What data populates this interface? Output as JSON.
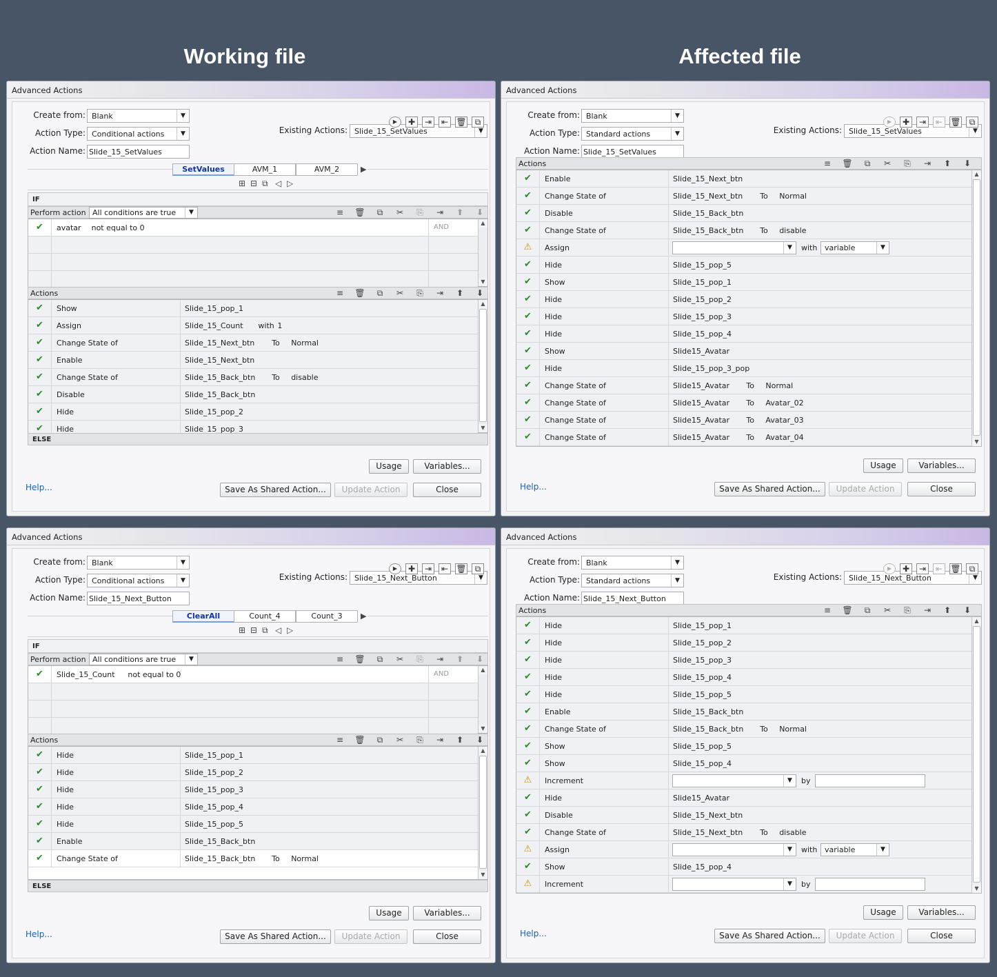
{
  "headings": {
    "working": "Working file",
    "affected": "Affected file"
  },
  "common": {
    "dialog_title": "Advanced Actions",
    "create_from_label": "Create from:",
    "action_type_label": "Action Type:",
    "action_name_label": "Action Name:",
    "existing_label": "Existing Actions:",
    "if_label": "IF",
    "else_label": "ELSE",
    "perform_label": "Perform action if:",
    "perform_value": "All conditions are true",
    "actions_label": "Actions",
    "and_label": "AND",
    "usage": "Usage",
    "variables": "Variables...",
    "help": "Help...",
    "save_shared": "Save As Shared Action...",
    "update": "Update Action",
    "close": "Close",
    "with": "with",
    "by": "by",
    "variable": "variable",
    "to": "To"
  },
  "d1": {
    "create_from": "Blank",
    "action_type": "Conditional actions",
    "action_name": "Slide_15_SetValues",
    "existing": "Slide_15_SetValues",
    "tabs": [
      "SetValues",
      "AVM_1",
      "AVM_2"
    ],
    "condition": {
      "var": "avatar",
      "op": "not equal to",
      "val": "0"
    },
    "actions": [
      {
        "a": "Show",
        "t": "Slide_15_pop_1"
      },
      {
        "a": "Assign",
        "t": "Slide_15_Count",
        "m": "with",
        "v": "1"
      },
      {
        "a": "Change State of",
        "t": "Slide_15_Next_btn",
        "m": "To",
        "v": "Normal"
      },
      {
        "a": "Enable",
        "t": "Slide_15_Next_btn"
      },
      {
        "a": "Change State of",
        "t": "Slide_15_Back_btn",
        "m": "To",
        "v": "disable"
      },
      {
        "a": "Disable",
        "t": "Slide_15_Back_btn"
      },
      {
        "a": "Hide",
        "t": "Slide_15_pop_2"
      },
      {
        "a": "Hide",
        "t": "Slide_15_pop_3"
      }
    ]
  },
  "d2": {
    "create_from": "Blank",
    "action_type": "Standard actions",
    "action_name": "Slide_15_SetValues",
    "existing": "Slide_15_SetValues",
    "actions": [
      {
        "a": "Enable",
        "t": "Slide_15_Next_btn"
      },
      {
        "a": "Change State of",
        "t": "Slide_15_Next_btn",
        "m": "To",
        "v": "Normal"
      },
      {
        "a": "Disable",
        "t": "Slide_15_Back_btn"
      },
      {
        "a": "Change State of",
        "t": "Slide_15_Back_btn",
        "m": "To",
        "v": "disable"
      },
      {
        "a": "Assign",
        "warn": true,
        "kind": "with"
      },
      {
        "a": "Hide",
        "t": "Slide_15_pop_5"
      },
      {
        "a": "Show",
        "t": "Slide_15_pop_1"
      },
      {
        "a": "Hide",
        "t": "Slide_15_pop_2"
      },
      {
        "a": "Hide",
        "t": "Slide_15_pop_3"
      },
      {
        "a": "Hide",
        "t": "Slide_15_pop_4"
      },
      {
        "a": "Show",
        "t": "Slide15_Avatar"
      },
      {
        "a": "Hide",
        "t": "Slide_15_pop_3_pop"
      },
      {
        "a": "Change State of",
        "t": "Slide15_Avatar",
        "m": "To",
        "v": "Normal"
      },
      {
        "a": "Change State of",
        "t": "Slide15_Avatar",
        "m": "To",
        "v": "Avatar_02"
      },
      {
        "a": "Change State of",
        "t": "Slide15_Avatar",
        "m": "To",
        "v": "Avatar_03"
      },
      {
        "a": "Change State of",
        "t": "Slide15_Avatar",
        "m": "To",
        "v": "Avatar_04"
      }
    ]
  },
  "d3": {
    "create_from": "Blank",
    "action_type": "Conditional actions",
    "action_name": "Slide_15_Next_Button",
    "existing": "Slide_15_Next_Button",
    "tabs": [
      "ClearAll",
      "Count_4",
      "Count_3"
    ],
    "condition": {
      "var": "Slide_15_Count",
      "op": "not equal to",
      "val": "0"
    },
    "actions": [
      {
        "a": "Hide",
        "t": "Slide_15_pop_1"
      },
      {
        "a": "Hide",
        "t": "Slide_15_pop_2"
      },
      {
        "a": "Hide",
        "t": "Slide_15_pop_3"
      },
      {
        "a": "Hide",
        "t": "Slide_15_pop_4"
      },
      {
        "a": "Hide",
        "t": "Slide_15_pop_5"
      },
      {
        "a": "Enable",
        "t": "Slide_15_Back_btn"
      },
      {
        "a": "Change State of",
        "t": "Slide_15_Back_btn",
        "m": "To",
        "v": "Normal"
      }
    ]
  },
  "d4": {
    "create_from": "Blank",
    "action_type": "Standard actions",
    "action_name": "Slide_15_Next_Button",
    "existing": "Slide_15_Next_Button",
    "actions": [
      {
        "a": "Hide",
        "t": "Slide_15_pop_1"
      },
      {
        "a": "Hide",
        "t": "Slide_15_pop_2"
      },
      {
        "a": "Hide",
        "t": "Slide_15_pop_3"
      },
      {
        "a": "Hide",
        "t": "Slide_15_pop_4"
      },
      {
        "a": "Hide",
        "t": "Slide_15_pop_5"
      },
      {
        "a": "Enable",
        "t": "Slide_15_Back_btn"
      },
      {
        "a": "Change State of",
        "t": "Slide_15_Back_btn",
        "m": "To",
        "v": "Normal"
      },
      {
        "a": "Show",
        "t": "Slide_15_pop_5"
      },
      {
        "a": "Show",
        "t": "Slide_15_pop_4"
      },
      {
        "a": "Increment",
        "warn": true,
        "kind": "by"
      },
      {
        "a": "Hide",
        "t": "Slide15_Avatar"
      },
      {
        "a": "Disable",
        "t": "Slide_15_Next_btn"
      },
      {
        "a": "Change State of",
        "t": "Slide_15_Next_btn",
        "m": "To",
        "v": "disable"
      },
      {
        "a": "Assign",
        "warn": true,
        "kind": "with"
      },
      {
        "a": "Show",
        "t": "Slide_15_pop_4"
      },
      {
        "a": "Increment",
        "warn": true,
        "kind": "by"
      }
    ]
  }
}
